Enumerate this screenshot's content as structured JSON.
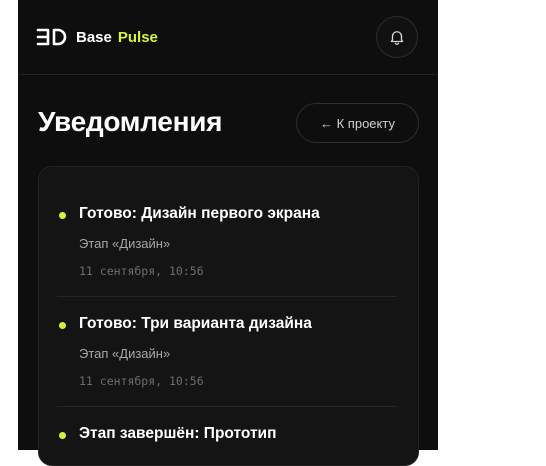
{
  "header": {
    "logo_mark": "ƎD",
    "logo_base": "Base",
    "logo_pulse": "Pulse",
    "accent_color": "#d9f23b",
    "bell_icon": "bell-icon"
  },
  "page": {
    "title": "Уведомления",
    "back_label": "← К проекту"
  },
  "notifications": [
    {
      "title": "Готово: Дизайн первого экрана",
      "stage": "Этап «Дизайн»",
      "date": "11 сентября, 10:56"
    },
    {
      "title": "Готово: Три варианта дизайна",
      "stage": "Этап «Дизайн»",
      "date": "11 сентября, 10:56"
    },
    {
      "title": "Этап завершён: Прототип",
      "stage": "",
      "date": ""
    }
  ]
}
